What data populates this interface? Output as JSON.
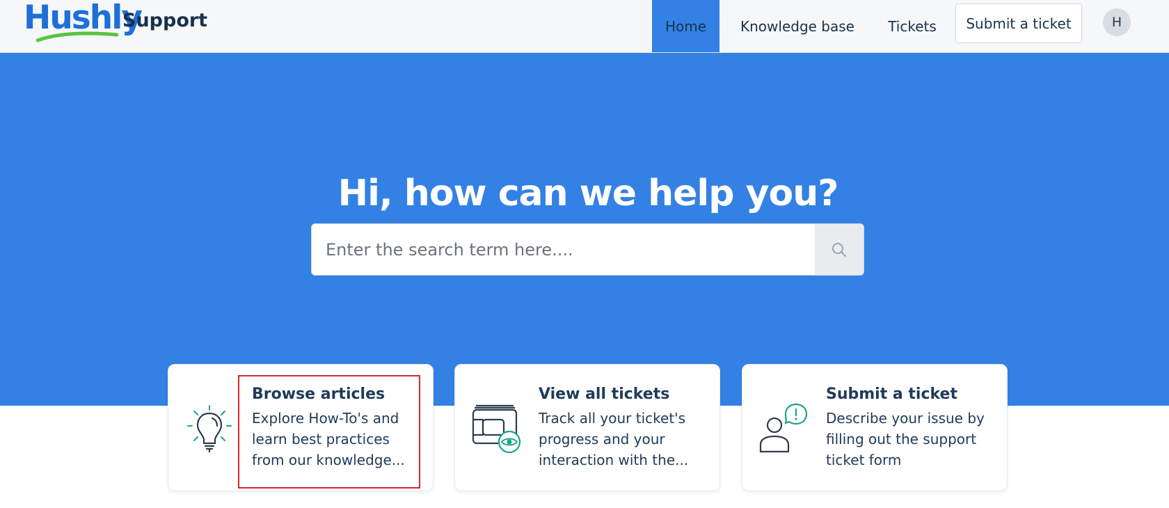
{
  "header": {
    "logo_text": "Hushly",
    "brand_suffix": "Support",
    "nav": [
      {
        "label": "Home"
      },
      {
        "label": "Knowledge base"
      },
      {
        "label": "Tickets"
      }
    ],
    "submit_button": "Submit a ticket",
    "avatar_initial": "H"
  },
  "hero": {
    "title": "Hi, how can we help you?",
    "search_placeholder": "Enter the search term here...."
  },
  "cards": [
    {
      "title": "Browse articles",
      "desc_lines": [
        "Explore How-To's and",
        "learn best practices",
        "from our knowledge..."
      ],
      "icon": "lightbulb-icon"
    },
    {
      "title": "View all tickets",
      "desc_lines": [
        "Track all your ticket's",
        "progress and your",
        "interaction with the..."
      ],
      "icon": "tickets-eye-icon"
    },
    {
      "title": "Submit a ticket",
      "desc_lines": [
        "Describe your issue by",
        "filling out the support",
        "ticket form"
      ],
      "icon": "user-alert-icon"
    }
  ],
  "colors": {
    "brand_blue": "#3381e4",
    "logo_blue": "#1e6fd9",
    "logo_green": "#5ac341",
    "text_dark": "#1f3a5a",
    "icon_teal": "#1aa584",
    "highlight_red": "#d9262d"
  }
}
